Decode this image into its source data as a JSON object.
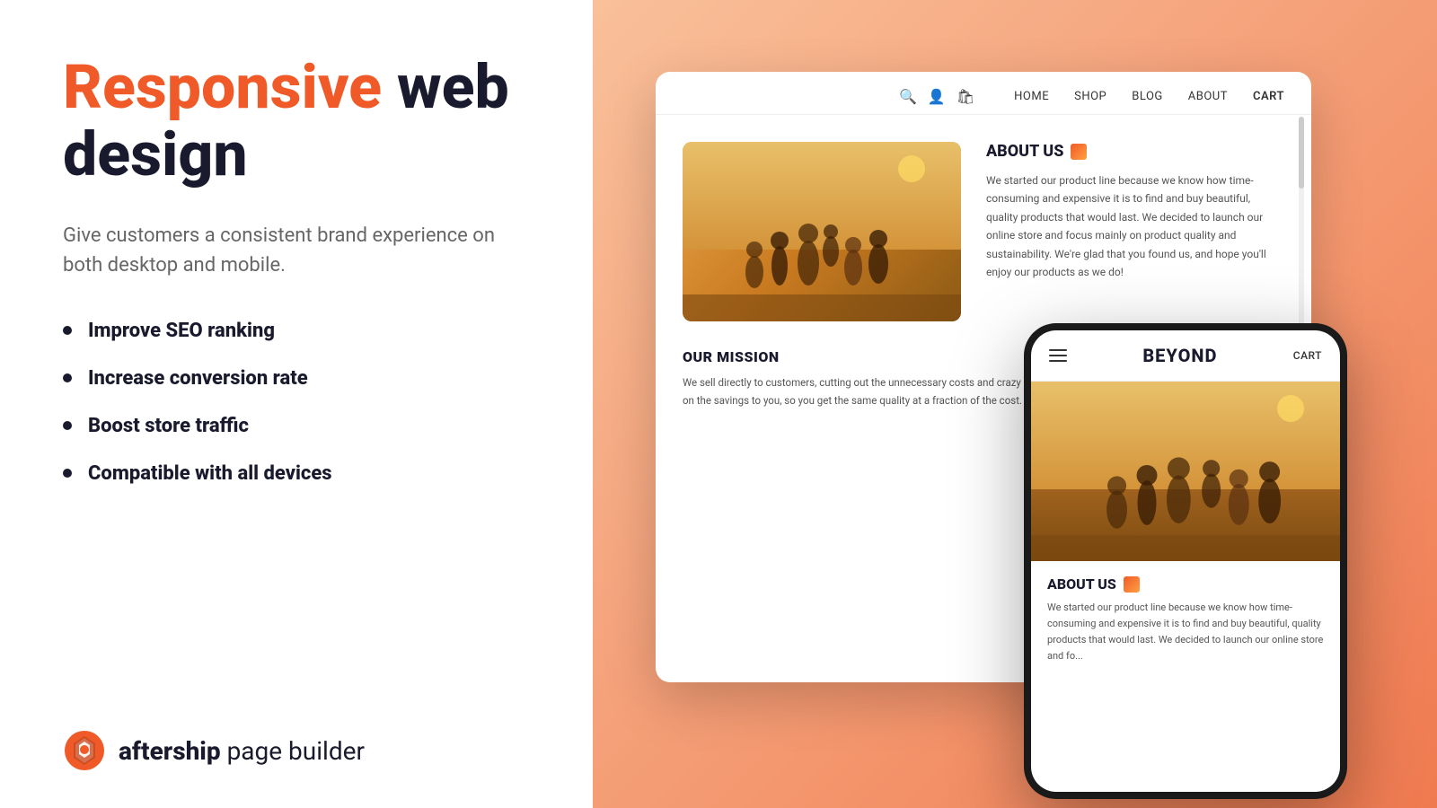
{
  "left": {
    "headline": {
      "orange": "Responsive",
      "dark": " web\ndesign"
    },
    "subtitle": "Give customers a consistent brand\nexperience on both desktop and mobile.",
    "features": [
      {
        "label": "Improve SEO ranking"
      },
      {
        "label": "Increase conversion rate"
      },
      {
        "label": "Boost store traffic"
      },
      {
        "label": "Compatible with all devices"
      }
    ],
    "brand": {
      "name": "aftership",
      "suffix": " page builder"
    }
  },
  "desktop_mockup": {
    "nav": {
      "links": [
        "HOME",
        "SHOP",
        "BLOG",
        "ABOUT",
        "CART"
      ]
    },
    "about": {
      "title": "ABOUT US",
      "text": "We started our product line because we know how time-consuming and expensive it is to find and buy beautiful, quality products that would last. We decided to launch our online store and focus mainly on product quality and sustainability. We're glad that you found us, and hope you'll enjoy our products as we do!"
    },
    "mission": {
      "title": "OUR MISSION",
      "text": "We sell directly to customers, cutting out the unnecessary costs and crazy markups that make products overly expensive. We pass on the savings to you, so you get the same quality at a fraction of the cost."
    }
  },
  "mobile_mockup": {
    "brand": "BEYOND",
    "cart": "CART",
    "about": {
      "title": "ABOUT US",
      "text": "We started our product line because we know how time-consuming and expensive it is to find and buy beautiful, quality products that would last. We decided to launch our online store and fo..."
    }
  }
}
